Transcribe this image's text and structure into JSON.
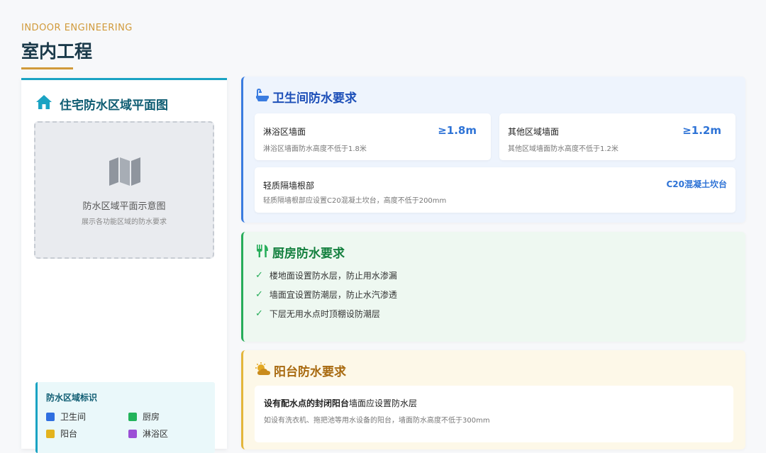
{
  "header": {
    "eyebrow": "INDOOR ENGINEERING",
    "title": "室内工程"
  },
  "left_panel": {
    "title": "住宅防水区域平面图",
    "title_icon": "home-icon",
    "map": {
      "icon": "map-icon",
      "caption": "防水区域平面示意图",
      "subcaption": "展示各功能区域的防水要求"
    },
    "legend": {
      "title": "防水区域标识",
      "items": [
        {
          "label": "卫生间",
          "color": "#2f6fe0"
        },
        {
          "label": "厨房",
          "color": "#22b35a"
        },
        {
          "label": "阳台",
          "color": "#e3b31e"
        },
        {
          "label": "淋浴区",
          "color": "#9b4fd6"
        }
      ]
    }
  },
  "bathroom": {
    "title": "卫生间防水要求",
    "icon": "bathtub-icon",
    "color": "#1d4fb8",
    "cards": [
      {
        "name": "淋浴区墙面",
        "value": "≥1.8m",
        "desc": "淋浴区墙面防水高度不低于1.8米"
      },
      {
        "name": "其他区域墙面",
        "value": "≥1.2m",
        "desc": "其他区域墙面防水高度不低于1.2米"
      },
      {
        "name": "轻质隔墙根部",
        "value": "C20混凝土坎台",
        "desc": "轻质隔墙根部应设置C20混凝土坎台，高度不低于200mm"
      }
    ]
  },
  "kitchen": {
    "title": "厨房防水要求",
    "icon": "utensils-icon",
    "color": "#14803f",
    "items": [
      "楼地面设置防水层，防止用水渗漏",
      "墙面宜设置防潮层，防止水汽渗透",
      "下层无用水点时顶棚设防潮层"
    ]
  },
  "balcony": {
    "title": "阳台防水要求",
    "icon": "sun-cloud-icon",
    "color": "#a86a10",
    "line1_bold": "设有配水点的封闭阳台",
    "line1_rest": "墙面应设置防水层",
    "line2": "如设有洗衣机、拖把池等用水设备的阳台，墙面防水高度不低于300mm"
  }
}
